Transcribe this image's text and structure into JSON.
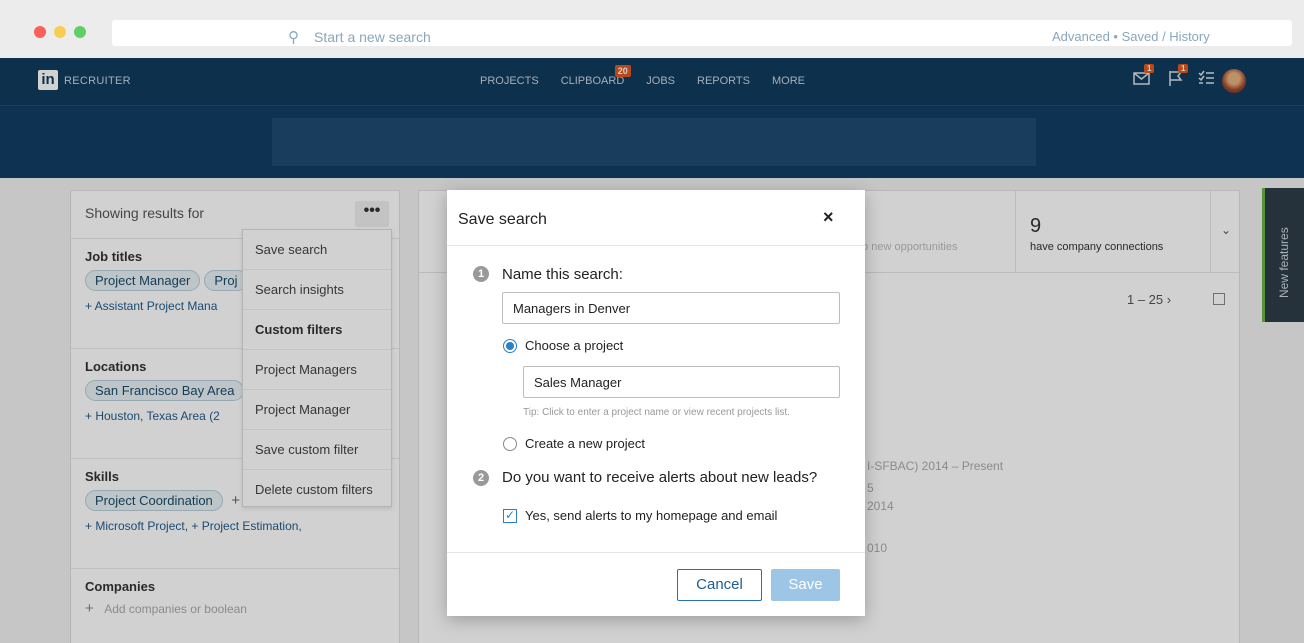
{
  "nav": {
    "brand": "RECRUITER",
    "links": [
      "PROJECTS",
      "CLIPBOARD",
      "JOBS",
      "REPORTS",
      "MORE"
    ],
    "clipboard_badge": "20",
    "messages_badge": "1",
    "flags_badge": "1"
  },
  "search": {
    "placeholder": "Start a new search",
    "advanced_label": "Advanced • Saved / History"
  },
  "left_panel": {
    "header": "Showing results for",
    "more_label": "•••",
    "job_titles": {
      "title": "Job titles",
      "pills": [
        "Project Manager",
        "Proj"
      ],
      "add_text": "+ Assistant Project Mana"
    },
    "locations": {
      "title": "Locations",
      "pills": [
        "San Francisco Bay Area"
      ],
      "add_text": "+ Houston, Texas Area (2"
    },
    "skills": {
      "title": "Skills",
      "pills": [
        "Project Coordination"
      ],
      "plus": "+",
      "add_text": "+ Microsoft Project, + Project Estimation,"
    },
    "companies": {
      "title": "Companies",
      "plus": "+",
      "add_placeholder": "Add companies or boolean"
    }
  },
  "dropdown": {
    "items": [
      "Save search",
      "Search insights",
      "Custom filters",
      "Project Managers",
      "Project Manager",
      "Save custom filter",
      "Delete custom filters"
    ]
  },
  "results": {
    "stat_number": "9",
    "stat_label": "have company connections",
    "faded_label": "to new opportunities",
    "pager": "1 – 25 ›",
    "partial_texts": [
      "I-SFBAC) 2014 – Present",
      "5",
      "2014",
      "010"
    ]
  },
  "side_tab": {
    "label": "New features"
  },
  "modal": {
    "title": "Save search",
    "close_label": "×",
    "step1_num": "1",
    "step1_label": "Name this search:",
    "search_name_value": "Managers in Denver",
    "choose_project_label": "Choose a project",
    "project_value": "Sales Manager",
    "tip": "Tip: Click to enter a project name or view recent projects list.",
    "create_project_label": "Create a new project",
    "step2_num": "2",
    "step2_label": "Do you want to receive alerts about new leads?",
    "alerts_label": "Yes, send alerts to my homepage and email",
    "cancel_label": "Cancel",
    "save_label": "Save"
  },
  "colors": {
    "nav_bg": "#113b5e",
    "accent": "#2a80c4",
    "badge": "#e35a1f"
  }
}
